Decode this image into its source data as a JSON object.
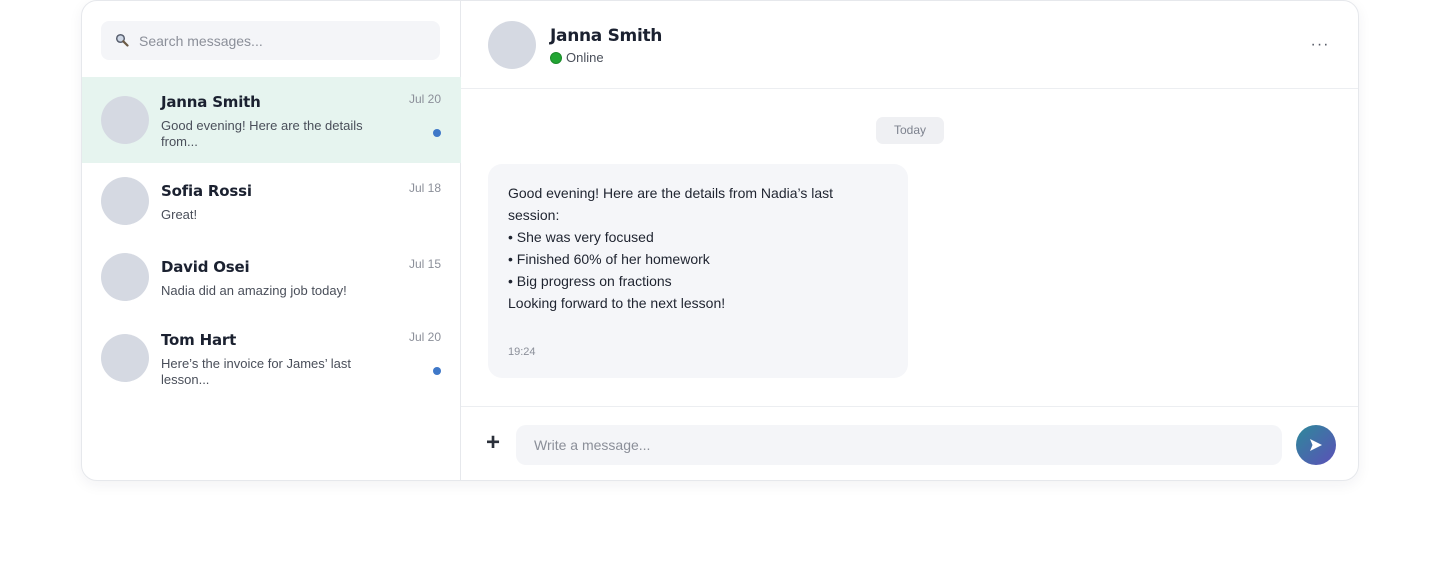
{
  "search": {
    "placeholder": "Search messages..."
  },
  "conversations": [
    {
      "name": "Janna Smith",
      "date": "Jul 20",
      "preview_line1": "Good evening! Here are the details",
      "preview_line2": "from...",
      "unread": true,
      "active": true
    },
    {
      "name": "Sofia Rossi",
      "date": "Jul 18",
      "preview_line1": "Great!",
      "preview_line2": "",
      "unread": false,
      "active": false
    },
    {
      "name": "David Osei",
      "date": "Jul 15",
      "preview_line1": "Nadia did an amazing job today!",
      "preview_line2": "",
      "unread": false,
      "active": false
    },
    {
      "name": "Tom Hart",
      "date": "Jul 20",
      "preview_line1": "Here’s the invoice for James’ last",
      "preview_line2": "lesson...",
      "unread": true,
      "active": false
    }
  ],
  "chat": {
    "contact_name": "Janna Smith",
    "status": "Online",
    "more_label": "···",
    "day_separator": "Today",
    "message": {
      "lines": [
        "Good evening! Here are the details from Nadia’s last",
        "session:",
        "• She was very focused",
        "• Finished 60% of her homework",
        "• Big progress on fractions",
        "",
        "Looking forward to the next lesson!"
      ],
      "time": "19:24"
    },
    "composer": {
      "plus_label": "+",
      "placeholder": "Write a message..."
    }
  },
  "colors": {
    "active_row": "#e6f4ef",
    "unread_dot": "#3f78c8",
    "online": "#22a533",
    "send_gradient_start": "#2d8a9a",
    "send_gradient_end": "#5c4fb8"
  },
  "icons": {
    "search": "search-icon",
    "send": "send-icon",
    "more": "more-icon",
    "attach": "plus-icon"
  }
}
